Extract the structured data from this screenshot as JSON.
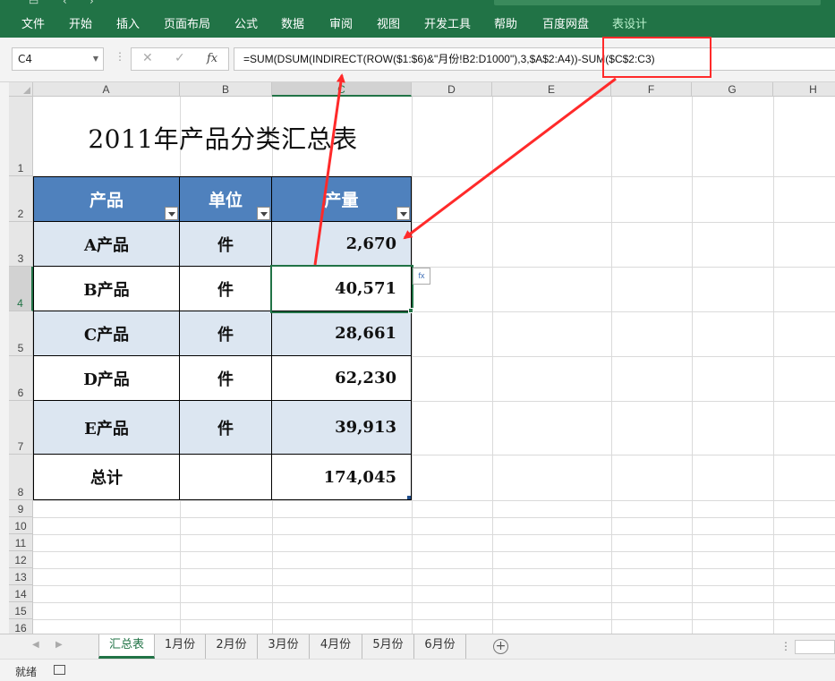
{
  "ribbon": {
    "tabs": [
      {
        "label": "文件"
      },
      {
        "label": "开始"
      },
      {
        "label": "插入"
      },
      {
        "label": "页面布局"
      },
      {
        "label": "公式"
      },
      {
        "label": "数据"
      },
      {
        "label": "审阅"
      },
      {
        "label": "视图"
      },
      {
        "label": "开发工具"
      },
      {
        "label": "帮助"
      },
      {
        "label": "百度网盘"
      },
      {
        "label": "表设计",
        "active": true
      }
    ]
  },
  "formula_bar": {
    "name_box": "C4",
    "fx_symbol": "fx",
    "formula": "=SUM(DSUM(INDIRECT(ROW($1:$6)&\"月份!B2:D1000\"),3,$A$2:A4))-SUM($C$2:C3)"
  },
  "columns": [
    "A",
    "B",
    "C",
    "D",
    "E",
    "F",
    "G",
    "H"
  ],
  "selected_column": "C",
  "rows": [
    "1",
    "2",
    "3",
    "4",
    "5",
    "6",
    "7",
    "8",
    "9",
    "10",
    "11",
    "12",
    "13",
    "14",
    "15",
    "16"
  ],
  "selected_row": "4",
  "sheet": {
    "title": "2011年产品分类汇总表",
    "headers": [
      "产品",
      "单位",
      "产量"
    ],
    "data_rows": [
      {
        "product": "A产品",
        "unit": "件",
        "qty": "2,670"
      },
      {
        "product": "B产品",
        "unit": "件",
        "qty": "40,571"
      },
      {
        "product": "C产品",
        "unit": "件",
        "qty": "28,661"
      },
      {
        "product": "D产品",
        "unit": "件",
        "qty": "62,230"
      },
      {
        "product": "E产品",
        "unit": "件",
        "qty": "39,913"
      }
    ],
    "total": {
      "label": "总计",
      "unit": "",
      "qty": "174,045"
    }
  },
  "sheet_tabs": [
    "汇总表",
    "1月份",
    "2月份",
    "3月份",
    "4月份",
    "5月份",
    "6月份"
  ],
  "active_sheet": "汇总表",
  "status": {
    "ready": "就绪"
  },
  "colors": {
    "accent": "#217346",
    "table_header": "#4f81bd",
    "band": "#dce6f1",
    "annotation": "#ff2a2a"
  },
  "icons": [
    "cancel-icon",
    "enter-icon",
    "function-icon",
    "add-sheet-icon",
    "macro-record-icon",
    "flash-fill-icon",
    "filter-dropdown-icon"
  ]
}
